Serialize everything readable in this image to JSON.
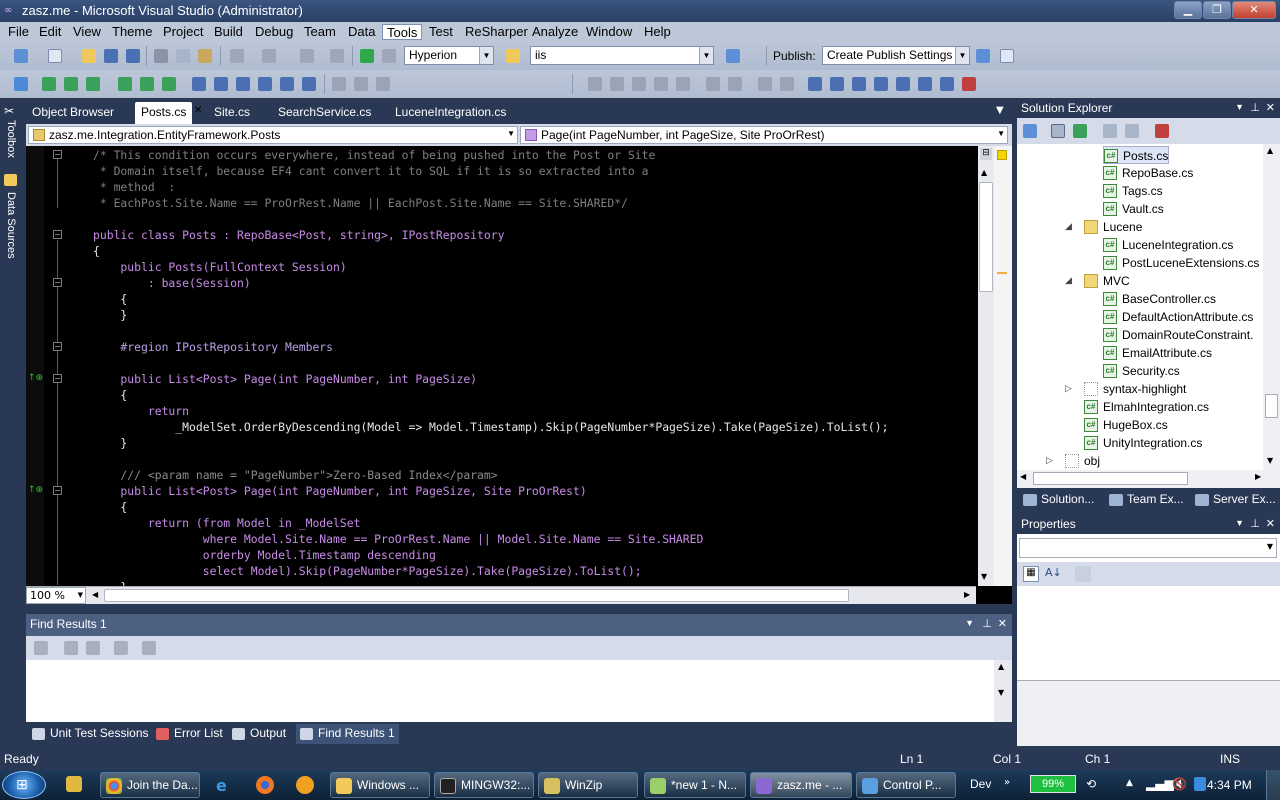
{
  "window": {
    "title": "zasz.me - Microsoft Visual Studio (Administrator)",
    "minimize": "▁",
    "maximize": "❐",
    "close": "✕"
  },
  "menu": [
    "File",
    "Edit",
    "View",
    "Theme",
    "Project",
    "Build",
    "Debug",
    "Team",
    "Data",
    "Tools",
    "Test",
    "ReSharper",
    "Analyze",
    "Window",
    "Help"
  ],
  "menu_active": "Tools",
  "toolbar": {
    "config": "Hyperion",
    "platform": "iis",
    "publish_label": "Publish:",
    "publish_combo": "Create Publish Settings"
  },
  "side_tabs": {
    "toolbox": "Toolbox",
    "data_sources": "Data Sources"
  },
  "tabs": [
    "Object Browser",
    "Posts.cs",
    "Site.cs",
    "SearchService.cs",
    "LuceneIntegration.cs"
  ],
  "active_tab": "Posts.cs",
  "navbar": {
    "class": "zasz.me.Integration.EntityFramework.Posts",
    "member": "Page(int PageNumber, int PageSize, Site ProOrRest)"
  },
  "code": [
    "/* This condition occurs everywhere, instead of being pushed into the Post or Site",
    " * Domain itself, because EF4 cant convert it to SQL if it is so extracted into a",
    " * method  :",
    " * EachPost.Site.Name == ProOrRest.Name || EachPost.Site.Name == Site.SHARED*/",
    "public class Posts : RepoBase<Post, string>, IPostRepository",
    "{",
    "    public Posts(FullContext Session)",
    "        : base(Session)",
    "    {",
    "    }",
    "    #region IPostRepository Members",
    "    public List<Post> Page(int PageNumber, int PageSize)",
    "    {",
    "        return",
    "            _ModelSet.OrderByDescending(Model => Model.Timestamp).Skip(PageNumber*PageSize).Take(PageSize).ToList();",
    "    }",
    "    /// <param name = \"PageNumber\">Zero-Based Index</param>",
    "    public List<Post> Page(int PageNumber, int PageSize, Site ProOrRest)",
    "    {",
    "        return (from Model in _ModelSet",
    "                where Model.Site.Name == ProOrRest.Name || Model.Site.Name == Site.SHARED",
    "                orderby Model.Timestamp descending",
    "                select Model).Skip(PageNumber*PageSize).Take(PageSize).ToList();",
    "    }"
  ],
  "zoom": "100 %",
  "find_results": {
    "title": "Find Results 1"
  },
  "bottom_tabs": [
    "Unit Test Sessions",
    "Error List",
    "Output",
    "Find Results 1"
  ],
  "solution_explorer": {
    "title": "Solution Explorer",
    "items": [
      {
        "label": "Posts.cs",
        "type": "cs"
      },
      {
        "label": "RepoBase.cs",
        "type": "cs"
      },
      {
        "label": "Tags.cs",
        "type": "cs"
      },
      {
        "label": "Vault.cs",
        "type": "cs"
      },
      {
        "label": "Lucene",
        "type": "folder"
      },
      {
        "label": "LuceneIntegration.cs",
        "type": "cs"
      },
      {
        "label": "PostLuceneExtensions.cs",
        "type": "cs"
      },
      {
        "label": "MVC",
        "type": "folder"
      },
      {
        "label": "BaseController.cs",
        "type": "cs"
      },
      {
        "label": "DefaultActionAttribute.cs",
        "type": "cs"
      },
      {
        "label": "DomainRouteConstraint.",
        "type": "cs"
      },
      {
        "label": "EmailAttribute.cs",
        "type": "cs"
      },
      {
        "label": "Security.cs",
        "type": "cs"
      },
      {
        "label": "syntax-highlight",
        "type": "folder-empty"
      },
      {
        "label": "ElmahIntegration.cs",
        "type": "cs"
      },
      {
        "label": "HugeBox.cs",
        "type": "cs"
      },
      {
        "label": "UnityIntegration.cs",
        "type": "cs"
      },
      {
        "label": "obj",
        "type": "folder-empty"
      }
    ],
    "tabs": [
      "Solution...",
      "Team Ex...",
      "Server Ex..."
    ]
  },
  "properties": {
    "title": "Properties"
  },
  "status": {
    "ready": "Ready",
    "ln": "Ln 1",
    "col": "Col 1",
    "ch": "Ch 1",
    "ins": "INS"
  },
  "taskbar": {
    "items": [
      "Join the Da...",
      "",
      "",
      "",
      "Windows ...",
      "MINGW32:...",
      "WinZip",
      "*new 1 - N...",
      "zasz.me - ...",
      "Control P..."
    ],
    "dev": "Dev",
    "battery": "99%",
    "clock": "4:34 PM"
  }
}
